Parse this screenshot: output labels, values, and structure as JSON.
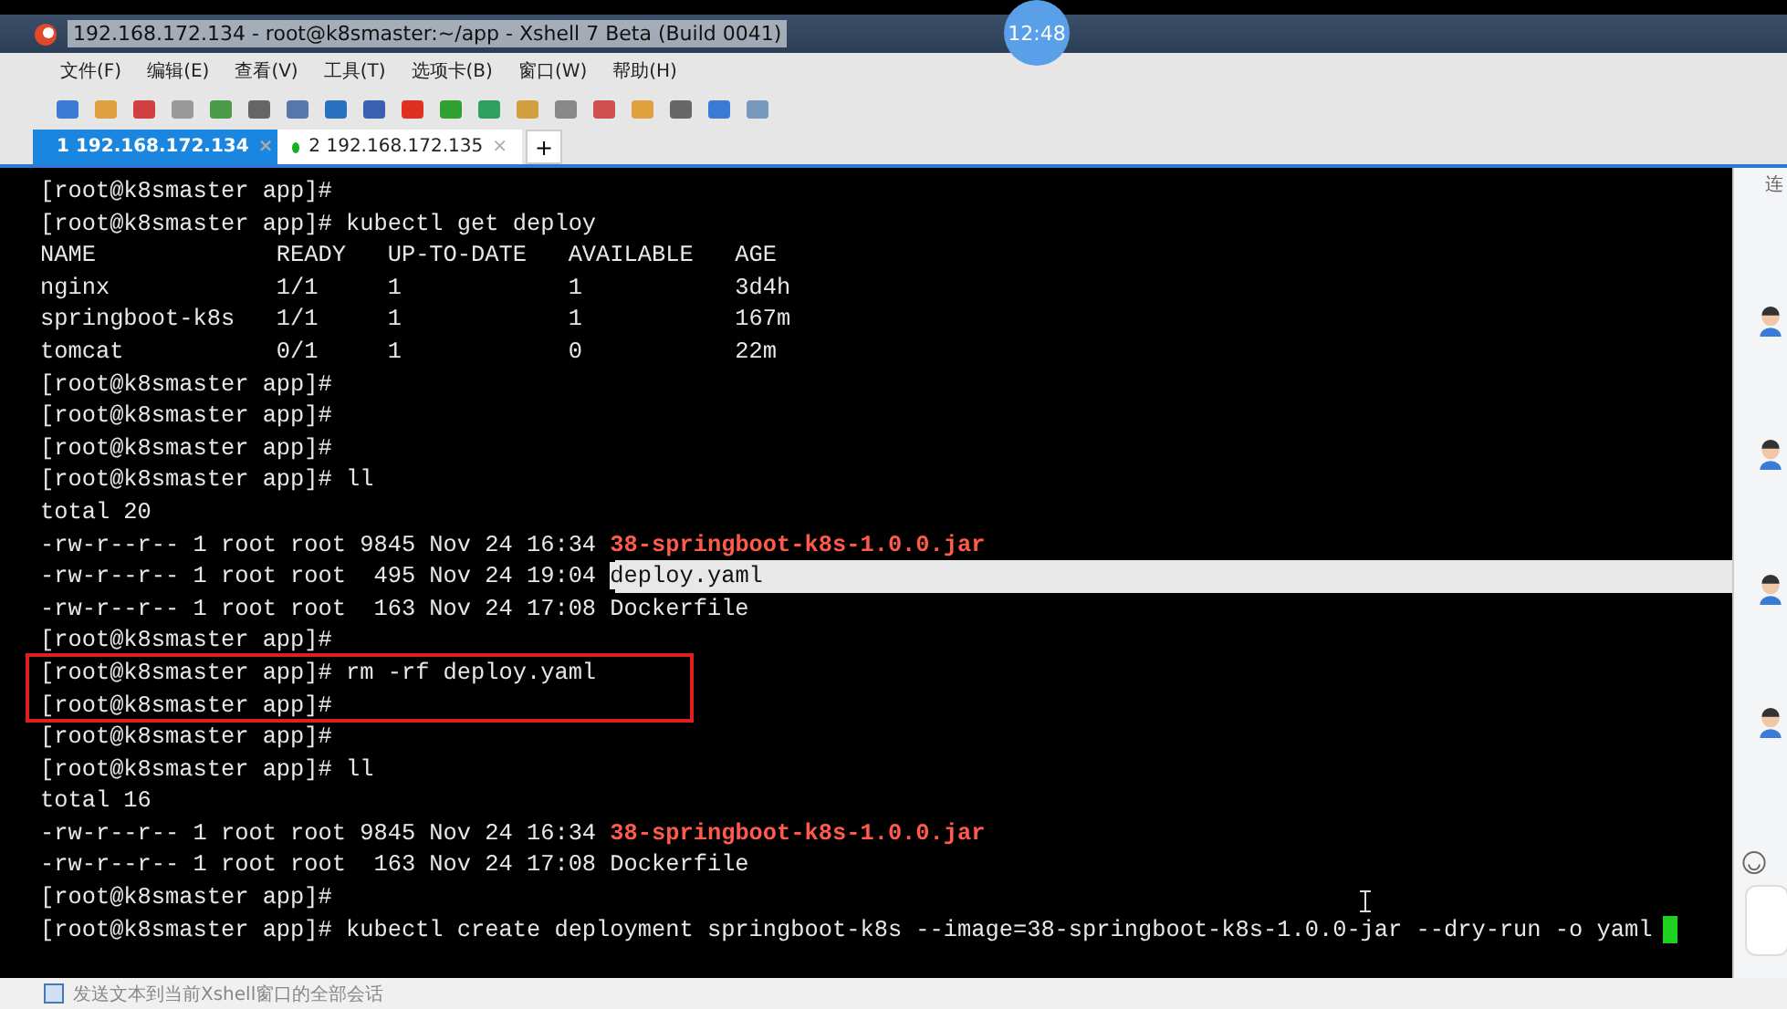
{
  "window": {
    "title": "192.168.172.134 - root@k8smaster:~/app - Xshell 7 Beta (Build 0041)",
    "clock": "12:48"
  },
  "menu": [
    "文件(F)",
    "编辑(E)",
    "查看(V)",
    "工具(T)",
    "选项卡(B)",
    "窗口(W)",
    "帮助(H)"
  ],
  "tabs": [
    {
      "label": "1 192.168.172.134",
      "close": "×",
      "selected": true
    },
    {
      "label": "2 192.168.172.135",
      "close": "×",
      "selected": false
    }
  ],
  "add_tab": "+",
  "terminal": {
    "lines": [
      [
        {
          "kind": "text",
          "text": "[root@k8smaster app]#"
        }
      ],
      [
        {
          "kind": "text",
          "text": "[root@k8smaster app]# kubectl get deploy"
        }
      ],
      [
        {
          "kind": "text",
          "text": "NAME             READY   UP-TO-DATE   AVAILABLE   AGE"
        }
      ],
      [
        {
          "kind": "text",
          "text": "nginx            1/1     1            1           3d4h"
        }
      ],
      [
        {
          "kind": "text",
          "text": "springboot-k8s   1/1     1            1           167m"
        }
      ],
      [
        {
          "kind": "text",
          "text": "tomcat           0/1     1            0           22m"
        }
      ],
      [
        {
          "kind": "text",
          "text": "[root@k8smaster app]#"
        }
      ],
      [
        {
          "kind": "text",
          "text": "[root@k8smaster app]#"
        }
      ],
      [
        {
          "kind": "text",
          "text": "[root@k8smaster app]#"
        }
      ],
      [
        {
          "kind": "text",
          "text": "[root@k8smaster app]# ll"
        }
      ],
      [
        {
          "kind": "text",
          "text": "total 20"
        }
      ],
      [
        {
          "kind": "text",
          "text": "-rw-r--r-- 1 root root 9845 Nov 24 16:34 "
        },
        {
          "kind": "jar",
          "text": "38-springboot-k8s-1.0.0.jar"
        }
      ],
      [
        {
          "kind": "text",
          "text": "-rw-r--r-- 1 root root  495 Nov 24 19:04 "
        },
        {
          "kind": "selected",
          "text": "deploy.yaml"
        }
      ],
      [
        {
          "kind": "text",
          "text": "-rw-r--r-- 1 root root  163 Nov 24 17:08 Dockerfile"
        }
      ],
      [
        {
          "kind": "text",
          "text": "[root@k8smaster app]#"
        }
      ],
      [
        {
          "kind": "text",
          "text": "[root@k8smaster app]# rm -rf deploy.yaml"
        }
      ],
      [
        {
          "kind": "text",
          "text": "[root@k8smaster app]#"
        }
      ],
      [
        {
          "kind": "text",
          "text": "[root@k8smaster app]#"
        }
      ],
      [
        {
          "kind": "text",
          "text": "[root@k8smaster app]# ll"
        }
      ],
      [
        {
          "kind": "text",
          "text": "total 16"
        }
      ],
      [
        {
          "kind": "text",
          "text": "-rw-r--r-- 1 root root 9845 Nov 24 16:34 "
        },
        {
          "kind": "jar",
          "text": "38-springboot-k8s-1.0.0.jar"
        }
      ],
      [
        {
          "kind": "text",
          "text": "-rw-r--r-- 1 root root  163 Nov 24 17:08 Dockerfile"
        }
      ],
      [
        {
          "kind": "text",
          "text": "[root@k8smaster app]#"
        }
      ],
      [
        {
          "kind": "text",
          "text": "[root@k8smaster app]# kubectl create deployment springboot-k8s --image=38-springboot-k8s-1.0.0-jar --dry-run -o yaml"
        },
        {
          "kind": "cursor"
        }
      ]
    ]
  },
  "side_panel": {
    "header": "连"
  },
  "status_bar": "发送文本到当前Xshell窗口的全部会话"
}
